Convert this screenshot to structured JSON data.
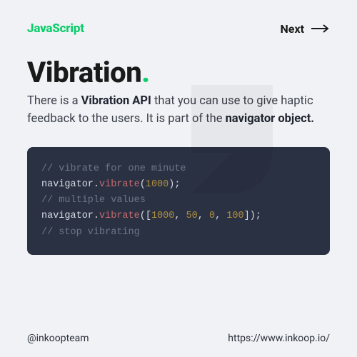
{
  "header": {
    "brand": "JavaScript",
    "next_label": "Next"
  },
  "title": {
    "text": "Vibration",
    "dot": "."
  },
  "description": {
    "prefix": "There is a ",
    "bold1": "Vibration API",
    "mid": " that you can use to give haptic feedback to the users. It is part of the ",
    "bold2": "navigator object."
  },
  "code": {
    "l1_comment": "// vibrate for one minute",
    "l2_obj": "navigator",
    "l2_dot": ".",
    "l2_fn": "vibrate",
    "l2_open": "(",
    "l2_arg": "1000",
    "l2_close": ");",
    "l3_comment": "// multiple values",
    "l4_obj": "navigator",
    "l4_dot": ".",
    "l4_fn": "vibrate",
    "l4_open": "([",
    "l4_a": "1000",
    "l4_c1": ", ",
    "l4_b": "50",
    "l4_c2": ", ",
    "l4_c": "0",
    "l4_c3": ", ",
    "l4_d": "100",
    "l4_close": "]);",
    "l5_comment": "// stop vibrating"
  },
  "footer": {
    "handle": "@inkoopteam",
    "url": "https://www.inkoop.io/"
  },
  "colors": {
    "accent": "#0cce6b",
    "code_bg": "#2a3142"
  }
}
